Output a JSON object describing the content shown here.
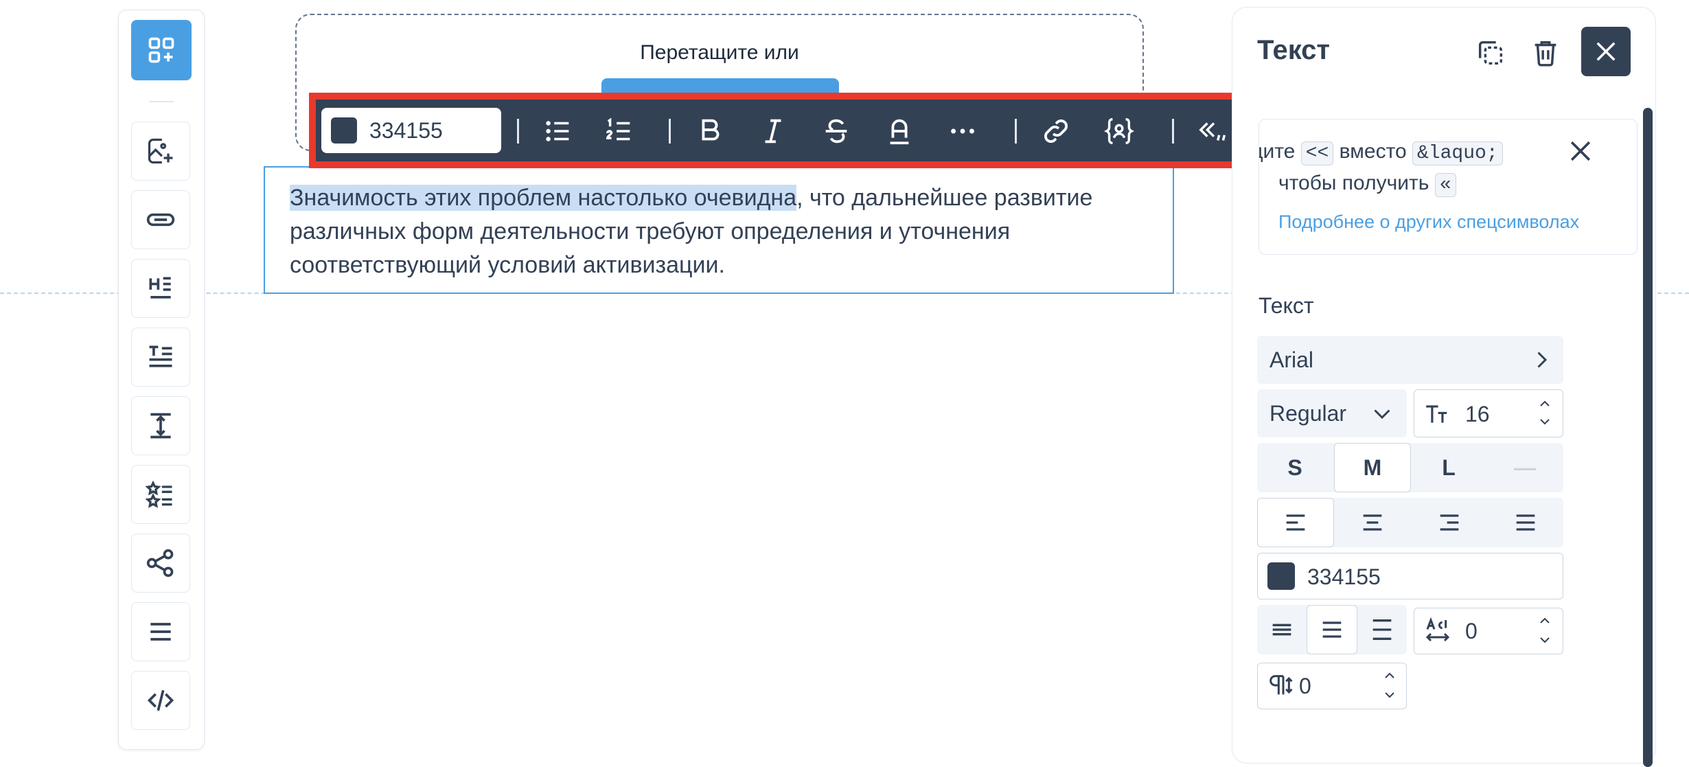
{
  "dropzone": {
    "text": "Перетащите или"
  },
  "content": {
    "selected_text": "Значимость этих проблем настолько очевидна",
    "rest_text": ", что дальнейшее развитие различных форм деятельности требуют определения и уточнения соответствующий условий активизации."
  },
  "format_toolbar": {
    "color_value": "334155",
    "color_swatch": "#334155",
    "buttons": [
      "bullet-list",
      "numbered-list",
      "bold",
      "italic",
      "strikethrough",
      "underline",
      "more",
      "link",
      "variable",
      "quotes",
      "clear-format"
    ]
  },
  "left_toolbar": {
    "items": [
      "add-block",
      "image",
      "button",
      "heading",
      "text",
      "spacer",
      "rating-list",
      "social",
      "menu",
      "html-code"
    ]
  },
  "panel": {
    "title": "Текст",
    "hint": {
      "prefix": "дите",
      "code_from": "<<",
      "middle": "вместо",
      "code_entity": "&laquo;",
      "line2": "чтобы получить",
      "code_result": "«",
      "link": "Подробнее о других спецсимволах"
    },
    "section_label": "Текст",
    "font_family": "Arial",
    "font_weight": "Regular",
    "font_size": "16",
    "sizes": [
      "S",
      "M",
      "L",
      "—"
    ],
    "selected_size": "M",
    "align_selected": "left",
    "text_color": "334155",
    "text_color_swatch": "#334155",
    "letter_spacing": "0",
    "line_spacing": "0"
  },
  "colors": {
    "accent": "#4a9fe3",
    "dark": "#334155",
    "highlight": "#e8392d",
    "selection": "#c9def5"
  }
}
